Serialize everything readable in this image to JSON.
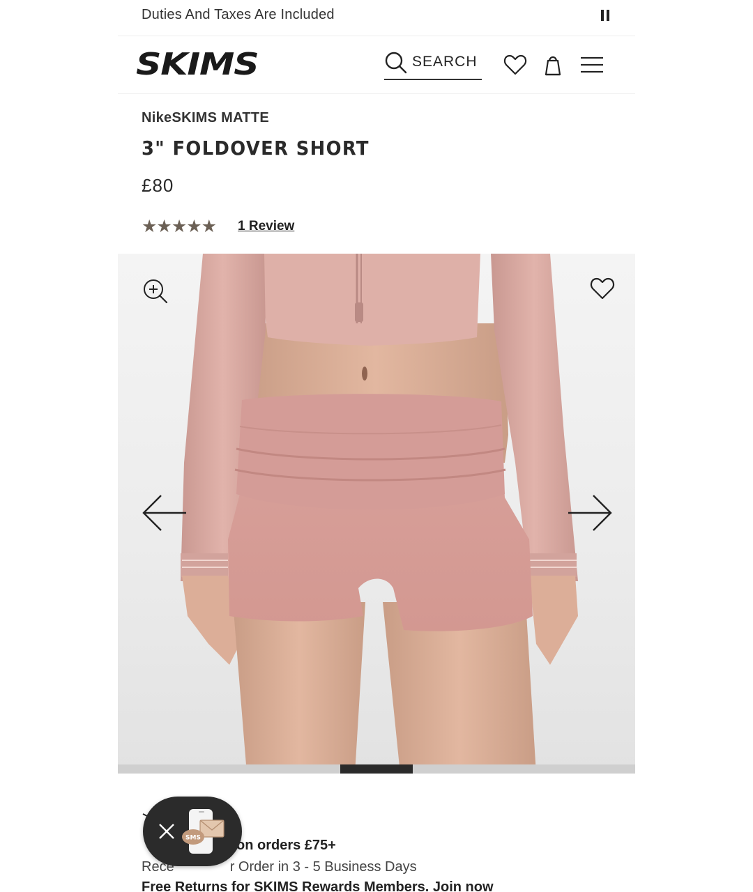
{
  "announcement": {
    "text": "Duties And Taxes Are Included"
  },
  "header": {
    "logo": "SKIMS",
    "search_label": "SEARCH"
  },
  "product": {
    "brand": "NikeSKIMS MATTE",
    "title": "3\" FOLDOVER SHORT",
    "price": "£80",
    "stars": "★★★★★",
    "rating_value": 5,
    "review_link": "1 Review"
  },
  "gallery": {
    "progress_fraction": 0.14,
    "slide_position": 0.43
  },
  "shipping": {
    "line1_visible": "on orders £75+",
    "line2_left": "Rece",
    "line2_right": "r Order in 3 - 5 Business Days",
    "line3": "Free Returns for SKIMS Rewards Members. Join now"
  },
  "sms_badge": {
    "label": "SMS"
  },
  "colors": {
    "product_pink": "#d49c97",
    "star_color": "#6b6055",
    "text_dark": "#222222"
  },
  "icons": [
    "pause-icon",
    "search-icon",
    "heart-icon",
    "bag-icon",
    "menu-icon",
    "zoom-in-icon",
    "arrow-left-icon",
    "arrow-right-icon",
    "close-icon",
    "sms-icon"
  ]
}
